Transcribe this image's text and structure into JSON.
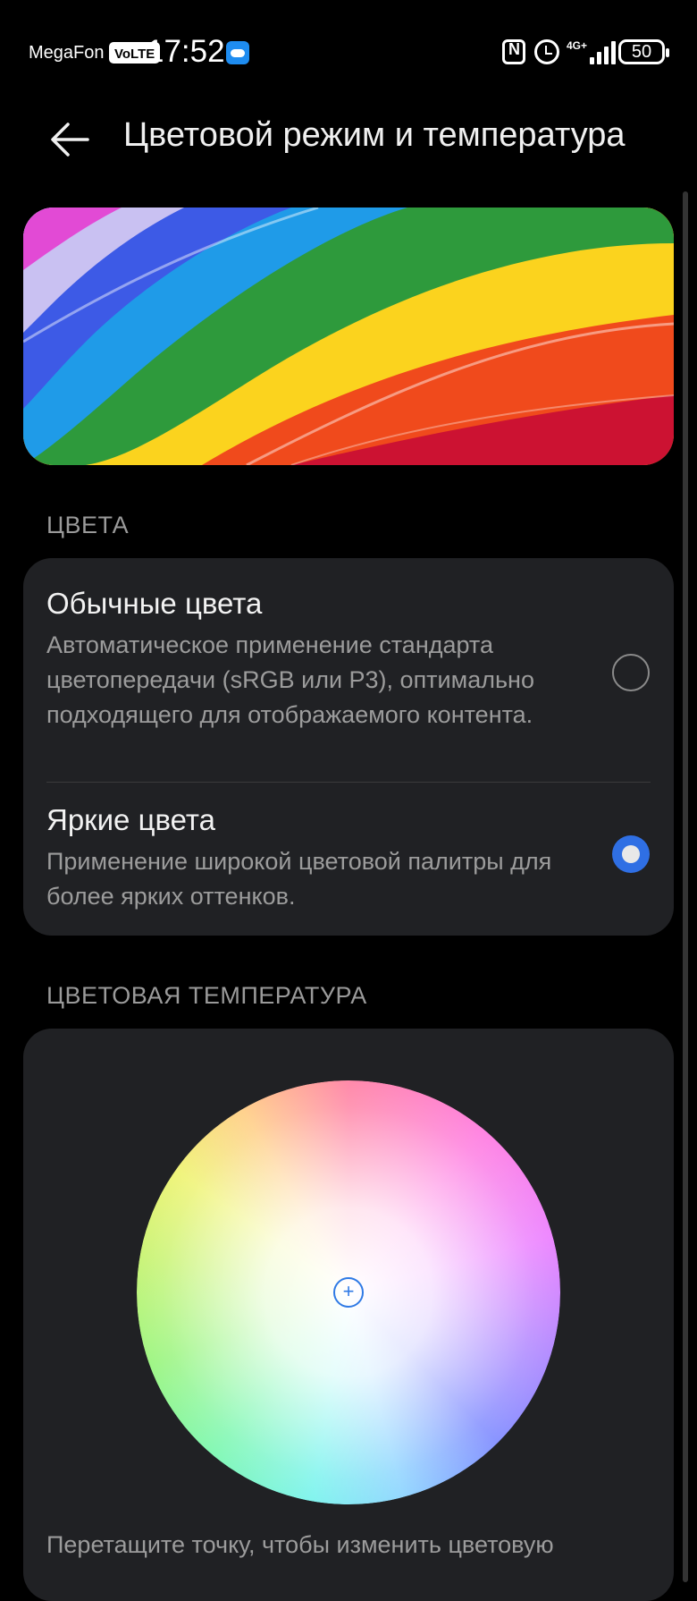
{
  "status_bar": {
    "carrier": "MegaFon",
    "volte": "VoLTE",
    "time": "17:52",
    "network": "4G+",
    "battery": "50",
    "icons": [
      "cloud-icon",
      "nfc-icon",
      "alarm-icon",
      "signal-icon",
      "battery-icon"
    ]
  },
  "header": {
    "back_icon": "arrow-left-icon",
    "title": "Цветовой режим и температура"
  },
  "colors_section": {
    "label": "ЦВЕТА",
    "options": [
      {
        "title": "Обычные цвета",
        "description": "Автоматическое применение стандарта цветопередачи (sRGB или P3), оптимально подходящего для отображаемого контента.",
        "selected": false
      },
      {
        "title": "Яркие цвета",
        "description": "Применение широкой цветовой палитры для более ярких оттенков.",
        "selected": true
      }
    ]
  },
  "temperature_section": {
    "label": "ЦВЕТОВАЯ ТЕМПЕРАТУРА",
    "picker_symbol": "+",
    "hint": "Перетащите точку, чтобы изменить цветовую"
  },
  "colors": {
    "background": "#000000",
    "card": "#202124",
    "accent": "#2f6fe4"
  }
}
